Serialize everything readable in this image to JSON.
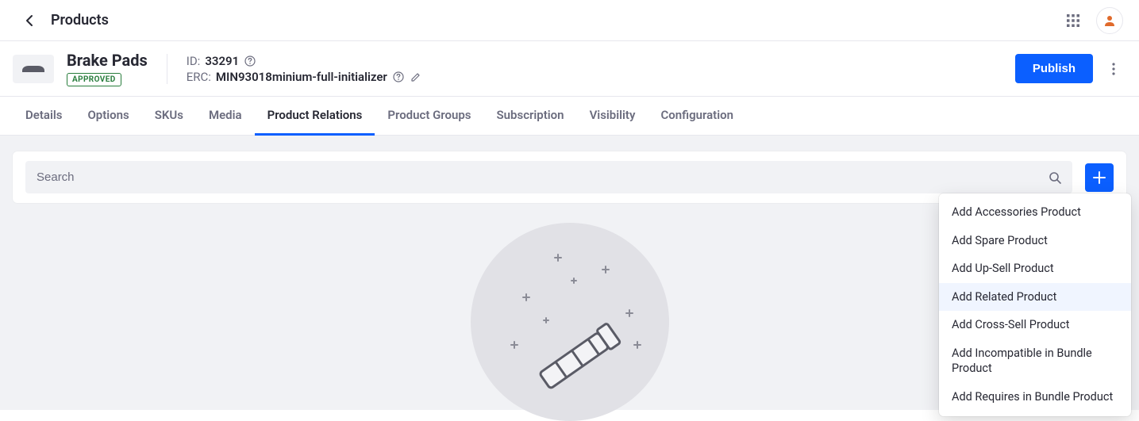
{
  "topbar": {
    "breadcrumb": "Products"
  },
  "header": {
    "title": "Brake Pads",
    "status": "APPROVED",
    "id_label": "ID: ",
    "id_value": "33291",
    "erc_label": "ERC: ",
    "erc_value": "MIN93018minium-full-initializer",
    "publish_label": "Publish"
  },
  "tabs": [
    {
      "label": "Details"
    },
    {
      "label": "Options"
    },
    {
      "label": "SKUs"
    },
    {
      "label": "Media"
    },
    {
      "label": "Product Relations",
      "active": true
    },
    {
      "label": "Product Groups"
    },
    {
      "label": "Subscription"
    },
    {
      "label": "Visibility"
    },
    {
      "label": "Configuration"
    }
  ],
  "search": {
    "placeholder": "Search"
  },
  "dropdown": {
    "items": [
      {
        "label": "Add Accessories Product"
      },
      {
        "label": "Add Spare Product"
      },
      {
        "label": "Add Up-Sell Product"
      },
      {
        "label": "Add Related Product",
        "hover": true
      },
      {
        "label": "Add Cross-Sell Product"
      },
      {
        "label": "Add Incompatible in Bundle Product"
      },
      {
        "label": "Add Requires in Bundle Product"
      }
    ]
  }
}
